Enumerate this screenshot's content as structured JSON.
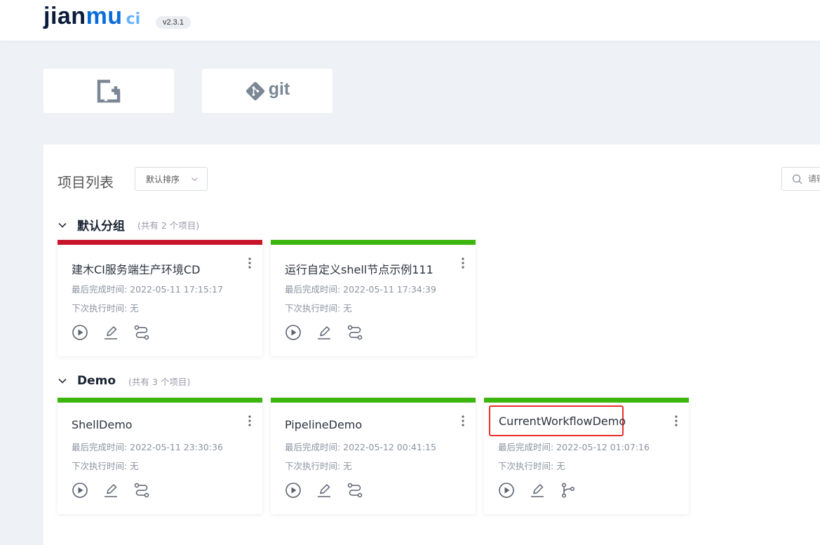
{
  "header": {
    "logo": {
      "part1": "jian",
      "part2": "mu",
      "part3": "ci"
    },
    "version": "v2.3.1"
  },
  "actions": {
    "create_icon": "add-project-icon",
    "git_icon": "git-icon",
    "git_label": "git"
  },
  "panel": {
    "title": "项目列表",
    "sort": {
      "value": "默认排序"
    },
    "search": {
      "placeholder": "请输入"
    }
  },
  "colors": {
    "success": "#3cb60e",
    "failed": "#c9152b",
    "highlight": "#e8302a"
  },
  "groups": [
    {
      "name": "默认分组",
      "count_label": "(共有 2 个项目)",
      "projects": [
        {
          "name": "建木CI服务端生产环境CD",
          "last_done": "最后完成时间: 2022-05-11 17:15:17",
          "next_run": "下次执行时间: 无",
          "status": "failed",
          "mode": "pipeline"
        },
        {
          "name": "运行自定义shell节点示例111",
          "last_done": "最后完成时间: 2022-05-11 17:34:39",
          "next_run": "下次执行时间: 无",
          "status": "success",
          "mode": "pipeline"
        }
      ]
    },
    {
      "name": "Demo",
      "count_label": "(共有 3 个项目)",
      "projects": [
        {
          "name": "ShellDemo",
          "last_done": "最后完成时间: 2022-05-11 23:30:36",
          "next_run": "下次执行时间: 无",
          "status": "success",
          "mode": "pipeline"
        },
        {
          "name": "PipelineDemo",
          "last_done": "最后完成时间: 2022-05-12 00:41:15",
          "next_run": "下次执行时间: 无",
          "status": "success",
          "mode": "pipeline"
        },
        {
          "name": "CurrentWorkflowDemo",
          "last_done": "最后完成时间: 2022-05-12 01:07:16",
          "next_run": "下次执行时间: 无",
          "status": "success",
          "mode": "workflow"
        }
      ]
    }
  ]
}
